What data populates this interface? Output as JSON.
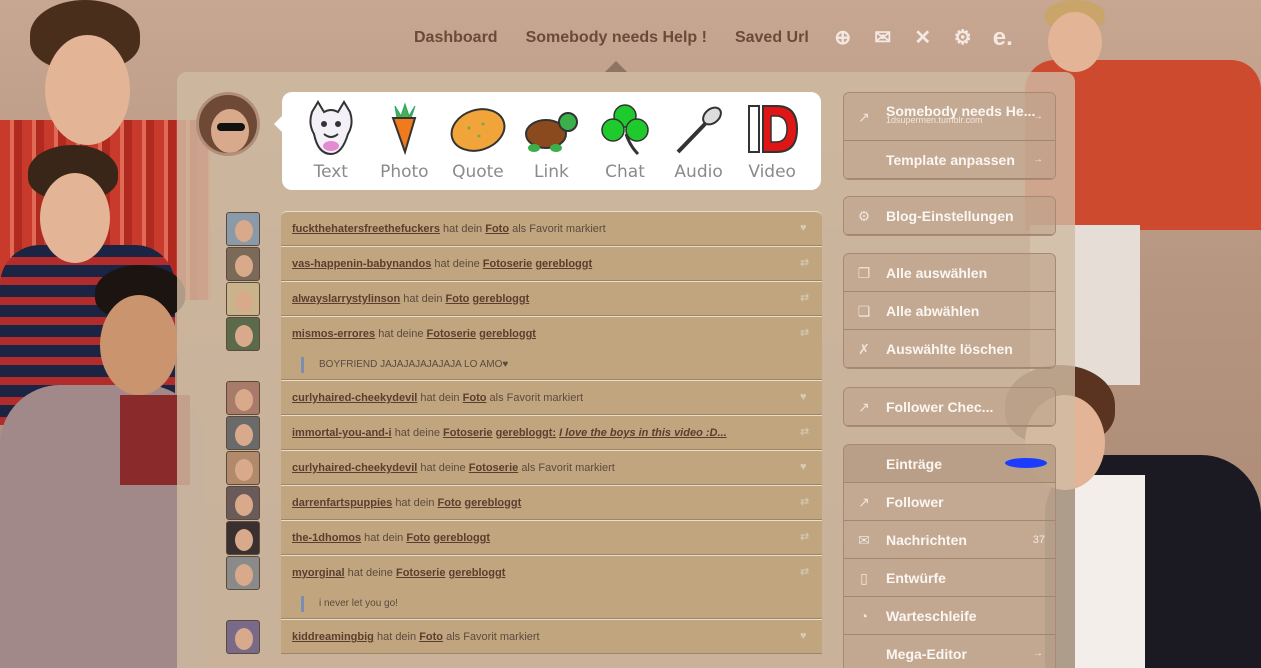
{
  "topnav": {
    "links": [
      "Dashboard",
      "Somebody needs Help !",
      "Saved Url"
    ],
    "icons": [
      "plus-circle-icon",
      "envelope-icon",
      "xkit-icon",
      "gear-icon",
      "e-icon"
    ],
    "icon_glyphs": [
      "⊕",
      "✉",
      "✕",
      "⚙",
      "e."
    ]
  },
  "post_types": [
    {
      "label": "Text",
      "icon": "cat-icon"
    },
    {
      "label": "Photo",
      "icon": "carrot-icon"
    },
    {
      "label": "Quote",
      "icon": "potato-icon"
    },
    {
      "label": "Link",
      "icon": "turtle-icon"
    },
    {
      "label": "Chat",
      "icon": "clover-icon"
    },
    {
      "label": "Audio",
      "icon": "spoon-icon"
    },
    {
      "label": "Video",
      "icon": "1d-logo-icon"
    }
  ],
  "notifications": [
    {
      "user": "fuckthehatersfreethefuckers",
      "pre": "hat dein",
      "links": [
        "Foto"
      ],
      "post": "als Favorit markiert",
      "quote": "",
      "reply": "",
      "action": "♥"
    },
    {
      "user": "vas-happenin-babynandos",
      "pre": "hat deine",
      "links": [
        "Fotoserie",
        "gerebloggt"
      ],
      "post": "",
      "quote": "",
      "reply": "",
      "action": "⇄"
    },
    {
      "user": "alwayslarrystylinson",
      "pre": "hat dein",
      "links": [
        "Foto",
        "gerebloggt"
      ],
      "post": "",
      "quote": "",
      "reply": "",
      "action": "⇄"
    },
    {
      "user": "mismos-errores",
      "pre": "hat deine",
      "links": [
        "Fotoserie",
        "gerebloggt"
      ],
      "post": "",
      "quote": "",
      "reply": "BOYFRIEND JAJAJAJAJAJAJA LO AMO♥",
      "action": "⇄"
    },
    {
      "user": "curlyhaired-cheekydevil",
      "pre": "hat dein",
      "links": [
        "Foto"
      ],
      "post": "als Favorit markiert",
      "quote": "",
      "reply": "",
      "action": "♥"
    },
    {
      "user": "immortal-you-and-i",
      "pre": "hat deine",
      "links": [
        "Fotoserie",
        "gerebloggt:"
      ],
      "post": "",
      "quote": "I love the boys in this video :D...",
      "reply": "",
      "action": "⇄"
    },
    {
      "user": "curlyhaired-cheekydevil",
      "pre": "hat deine",
      "links": [
        "Fotoserie"
      ],
      "post": "als Favorit markiert",
      "quote": "",
      "reply": "",
      "action": "♥"
    },
    {
      "user": "darrenfartspuppies",
      "pre": "hat dein",
      "links": [
        "Foto",
        "gerebloggt"
      ],
      "post": "",
      "quote": "",
      "reply": "",
      "action": "⇄"
    },
    {
      "user": "the-1dhomos",
      "pre": "hat dein",
      "links": [
        "Foto",
        "gerebloggt"
      ],
      "post": "",
      "quote": "",
      "reply": "",
      "action": "⇄"
    },
    {
      "user": "myorginal",
      "pre": "hat deine",
      "links": [
        "Fotoserie",
        "gerebloggt"
      ],
      "post": "",
      "quote": "",
      "reply": "i never let you go!",
      "action": "⇄"
    },
    {
      "user": "kiddreamingbig",
      "pre": "hat dein",
      "links": [
        "Foto"
      ],
      "post": "als Favorit markiert",
      "quote": "",
      "reply": "",
      "action": "♥"
    }
  ],
  "right_menu": {
    "blog_title": "Somebody needs He...",
    "blog_url": "1dsupermen.tumblr.com",
    "customize": "Template anpassen",
    "blog_settings": "Blog-Einstellungen",
    "select_all": "Alle auswählen",
    "deselect_all": "Alle abwählen",
    "delete_selected": "Auswählte löschen",
    "follower_check": "Follower Chec...",
    "posts": "Einträge",
    "followers": "Follower",
    "messages": "Nachrichten",
    "messages_count": "37",
    "drafts": "Entwürfe",
    "queue": "Warteschleife",
    "mass_editor": "Mega-Editor"
  }
}
